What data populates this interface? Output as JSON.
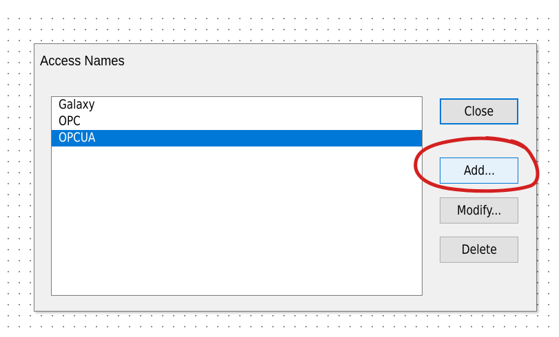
{
  "dialog": {
    "title": "Access Names"
  },
  "access_names": {
    "items": [
      {
        "label": "Galaxy",
        "selected": false
      },
      {
        "label": "OPC",
        "selected": false
      },
      {
        "label": "OPCUA",
        "selected": true
      }
    ]
  },
  "buttons": {
    "close": "Close",
    "add": "Add...",
    "modify": "Modify...",
    "delete": "Delete"
  },
  "colors": {
    "selection": "#0078d7",
    "annotation": "#d42020"
  }
}
